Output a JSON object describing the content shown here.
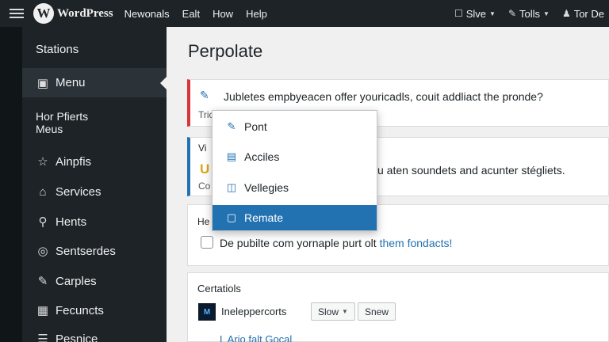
{
  "topbar": {
    "site_name": "WordPress",
    "menu": [
      "Newonals",
      "Ealt",
      "How",
      "Help"
    ],
    "right": [
      {
        "icon": "lock-icon",
        "label": "Slve"
      },
      {
        "icon": "tools-icon",
        "label": "Tolls"
      },
      {
        "icon": "user-icon",
        "label": "Tor De"
      }
    ]
  },
  "sidebar": {
    "heading_top": "Stations",
    "active_item": "Menu",
    "heading_mid": "Hor Pfierts\nMeus",
    "items": [
      {
        "icon": "star-icon",
        "label": "Ainpfis"
      },
      {
        "icon": "services-icon",
        "label": "Services"
      },
      {
        "icon": "hints-icon",
        "label": "Hents"
      },
      {
        "icon": "settings-icon",
        "label": "Sentserdes"
      },
      {
        "icon": "brush-icon",
        "label": "Carples"
      },
      {
        "icon": "features-icon",
        "label": "Fecuncts"
      },
      {
        "icon": "presets-icon",
        "label": "Pesnice"
      }
    ]
  },
  "main": {
    "title": "Perpolate",
    "notice1": {
      "text": "Jubletes empbyeacen offer youricadls, couit addliact the pronde?",
      "sub": "Tric"
    },
    "notice2": {
      "label": "Vi",
      "text": "u aten soundets and acunter stégliets.",
      "sub": "Co"
    },
    "panel3": {
      "label": "He",
      "text": "De pubilte com yornaple purt olt ",
      "link": "them fondacts!"
    },
    "panel4": {
      "label": "Certatiols",
      "product_icon_text": "M",
      "name": "Ineleppercorts",
      "button1": "Slow",
      "button2": "Snew",
      "link": "L Ario falt Gocal"
    }
  },
  "dropdown": {
    "items": [
      {
        "icon": "pencil-icon",
        "label": "Pont"
      },
      {
        "icon": "articles-icon",
        "label": "Acciles"
      },
      {
        "icon": "book-icon",
        "label": "Vellegies"
      },
      {
        "icon": "remote-icon",
        "label": "Remate"
      }
    ],
    "selected": "Remate"
  },
  "colors": {
    "admin_bar": "#1d2327",
    "accent": "#2271b1",
    "error": "#d63638"
  }
}
